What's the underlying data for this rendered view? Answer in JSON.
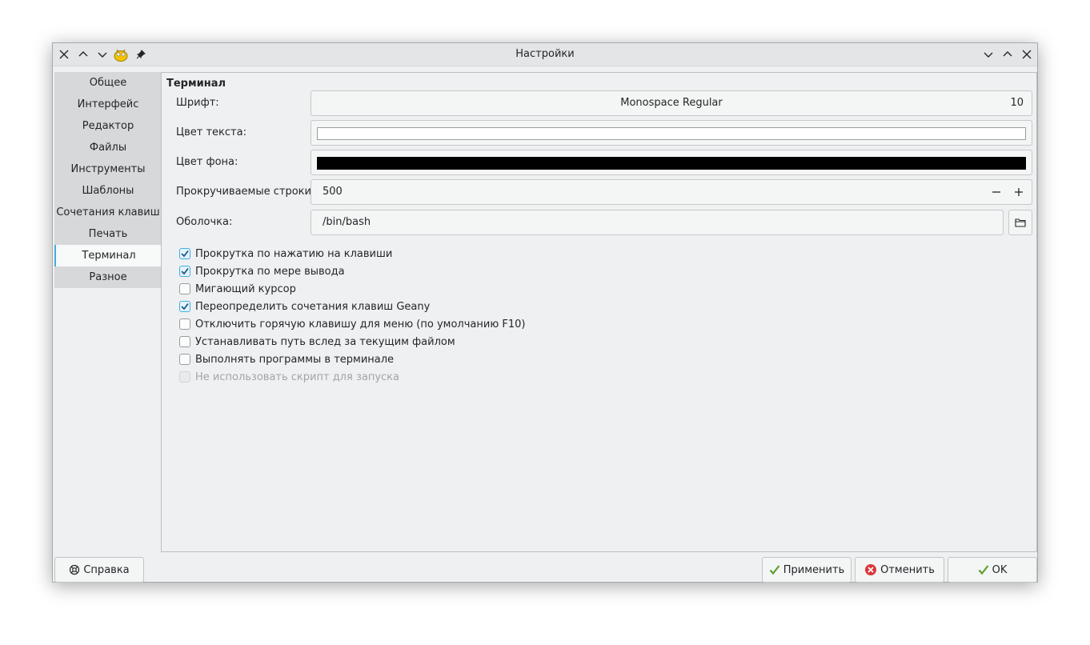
{
  "window": {
    "title": "Настройки"
  },
  "sidebar": {
    "items": [
      {
        "label": "Общее"
      },
      {
        "label": "Интерфейс"
      },
      {
        "label": "Редактор"
      },
      {
        "label": "Файлы"
      },
      {
        "label": "Инструменты"
      },
      {
        "label": "Шаблоны"
      },
      {
        "label": "Сочетания клавиш"
      },
      {
        "label": "Печать"
      },
      {
        "label": "Терминал",
        "active": true
      },
      {
        "label": "Разное"
      }
    ]
  },
  "terminal": {
    "section_title": "Терминал",
    "font_label": "Шрифт:",
    "font_name": "Monospace Regular",
    "font_size": "10",
    "text_color_label": "Цвет текста:",
    "text_color": "#ffffff",
    "bg_color_label": "Цвет фона:",
    "bg_color": "#000000",
    "scrollback_label": "Прокручиваемые строки:",
    "scrollback_value": "500",
    "shell_label": "Оболочка:",
    "shell_value": "/bin/bash",
    "checkboxes": [
      {
        "label": "Прокрутка по нажатию на клавиши",
        "checked": true
      },
      {
        "label": "Прокрутка по мере вывода",
        "checked": true
      },
      {
        "label": "Мигающий курсор",
        "checked": false
      },
      {
        "label": "Переопределить сочетания клавиш Geany",
        "checked": true
      },
      {
        "label": "Отключить горячую клавишу для меню (по умолчанию F10)",
        "checked": false
      },
      {
        "label": "Устанавливать путь вслед за текущим файлом",
        "checked": false
      },
      {
        "label": "Выполнять программы в терминале",
        "checked": false
      },
      {
        "label": "Не использовать скрипт для запуска",
        "checked": false,
        "disabled": true
      }
    ]
  },
  "buttons": {
    "help": "Справка",
    "apply": "Применить",
    "cancel": "Отменить",
    "ok": "OK"
  },
  "colors": {
    "accent": "#3daee9",
    "check": "#1d5a8a",
    "cancel_icon": "#d9383a",
    "ok_icon": "#5f9f2f"
  }
}
